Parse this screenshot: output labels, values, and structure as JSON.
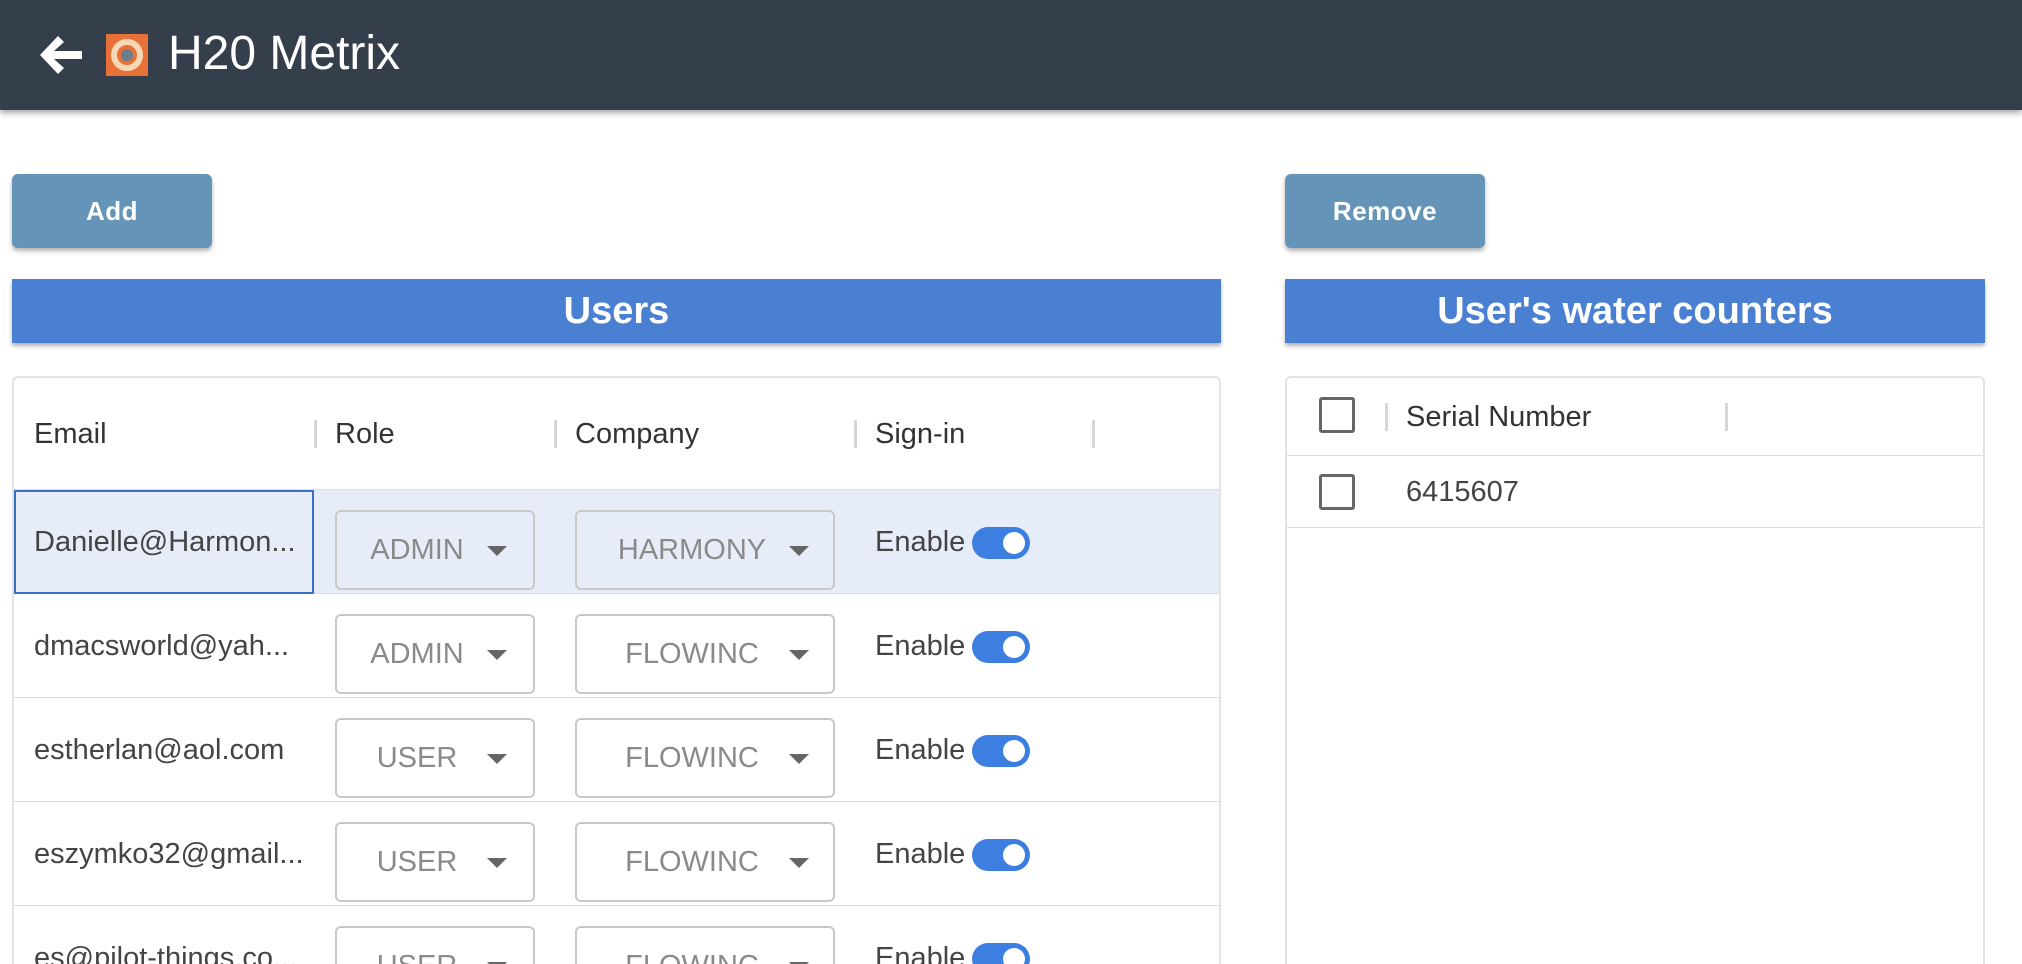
{
  "app": {
    "title": "H20 Metrix"
  },
  "toolbar": {
    "add_label": "Add",
    "remove_label": "Remove"
  },
  "users": {
    "header": "Users",
    "columns": {
      "email": "Email",
      "role": "Role",
      "company": "Company",
      "signin": "Sign-in"
    },
    "rows": [
      {
        "email": "Danielle@Harmon...",
        "role": "ADMIN",
        "company": "HARMONY",
        "signin": "Enable",
        "enabled": true,
        "selected": true
      },
      {
        "email": "dmacsworld@yah...",
        "role": "ADMIN",
        "company": "FLOWINC",
        "signin": "Enable",
        "enabled": true,
        "selected": false
      },
      {
        "email": "estherlan@aol.com",
        "role": "USER",
        "company": "FLOWINC",
        "signin": "Enable",
        "enabled": true,
        "selected": false
      },
      {
        "email": "eszymko32@gmail...",
        "role": "USER",
        "company": "FLOWINC",
        "signin": "Enable",
        "enabled": true,
        "selected": false
      },
      {
        "email": "es@pilot-things.co...",
        "role": "USER",
        "company": "FLOWINC",
        "signin": "Enable",
        "enabled": true,
        "selected": false
      }
    ]
  },
  "counters": {
    "header": "User's water counters",
    "columns": {
      "serial": "Serial Number"
    },
    "rows": [
      {
        "serial": "6415607",
        "checked": false
      }
    ]
  },
  "colors": {
    "appbar": "#343f4b",
    "button": "#6495b8",
    "section_header": "#4a80d2",
    "toggle_on": "#3d7fe0",
    "selected_row": "#e7edf8"
  }
}
